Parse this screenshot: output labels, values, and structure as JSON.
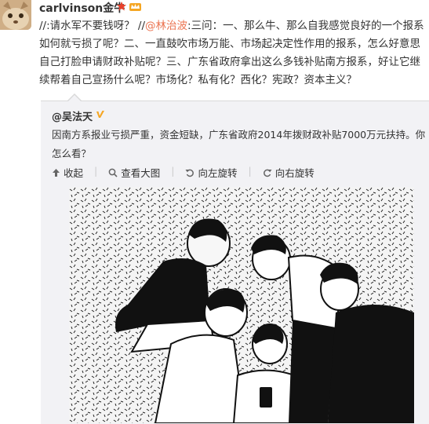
{
  "post": {
    "username": "carlvinson金牛",
    "lines": [
      "//:请水军不要钱呀？ //",
      "@林治波",
      ":三问：一、那么牛、那么自我感觉良好的一个报系",
      "如何就亏损了呢？二、一直鼓吹市场万能、市场起决定性作用的报系，怎么好意思",
      "自己打脸申请财政补贴呢？三、广东省政府拿出这么多钱补贴南方报系，好让它继",
      "续帮着自己宣扬什么呢？市场化？私有化？西化？宪政？资本主义？"
    ]
  },
  "repost": {
    "author": "@吴法天",
    "text": "因南方系报业亏损严重，资金短缺，广东省政府2014年拨财政补贴7000万元扶持。你怎么看？",
    "actions": {
      "collapse": "收起",
      "view_large": "查看大图",
      "rotate_left": "向左旋转",
      "rotate_right": "向右旋转"
    }
  },
  "colors": {
    "mention": "#eb7350",
    "repost_bg": "#f2f2f5",
    "verified": "#f5a623"
  }
}
